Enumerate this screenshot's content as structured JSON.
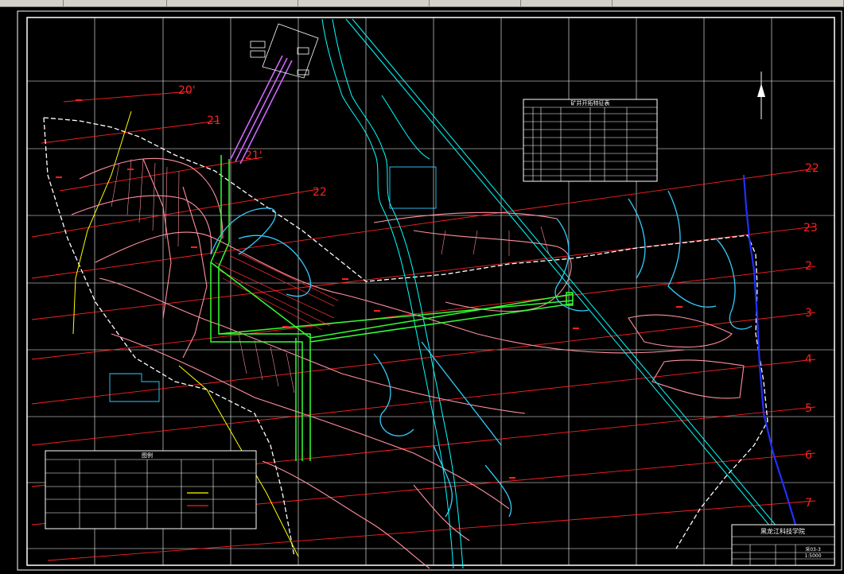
{
  "toolbar": {
    "segments": [
      "",
      "",
      "",
      "",
      "",
      "",
      ""
    ]
  },
  "section_labels": {
    "l20p": "20'",
    "l21": "21",
    "l21p": "21'",
    "l22a": "22",
    "l22b": "22",
    "l23": "23",
    "l2": "2",
    "l3": "3",
    "l4": "4",
    "l5": "5",
    "l6": "6",
    "l7": "7"
  },
  "table_title": "矿井开拓特征表",
  "legend_title": "图例",
  "title_block": {
    "institution": "黑龙江科技学院",
    "scale": "1:5000",
    "drawing_no": "采03-3"
  },
  "colors": {
    "frame": "#ffffff",
    "seam": "#ff8fa0",
    "contour": "#33ccff",
    "roadway": "#33ff33",
    "shaft": "#cc66ff",
    "section_line": "#ff2020",
    "fault": "#ffff00",
    "river": "#00ffff",
    "boundary_blue": "#2030ff"
  },
  "icons": [
    "north-arrow-icon"
  ]
}
